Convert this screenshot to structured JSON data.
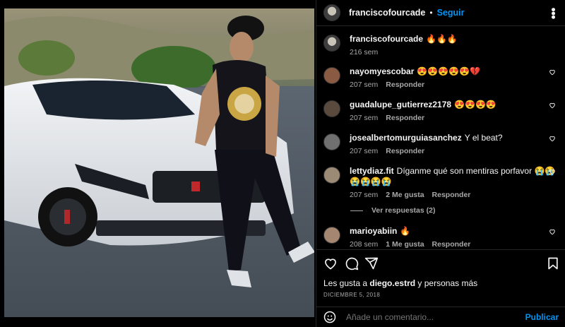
{
  "post": {
    "username": "franciscofourcade",
    "follow_label": "Seguir",
    "more_icon": "more-options-icon",
    "caption_user": "franciscofourcade",
    "caption_text": "🔥🔥🔥",
    "caption_age": "216 sem"
  },
  "comments": [
    {
      "user": "nayomyescobar",
      "text": "😍😍😍😍😍💔",
      "age": "207 sem",
      "likes": "",
      "reply": "Responder"
    },
    {
      "user": "guadalupe_gutierrez2178",
      "text": "😍😍😍😍",
      "age": "207 sem",
      "likes": "",
      "reply": "Responder"
    },
    {
      "user": "josealbertomurguiasanchez",
      "text": "Y el beat?",
      "age": "207 sem",
      "likes": "",
      "reply": "Responder"
    },
    {
      "user": "lettydiaz.fit",
      "text": "Díganme qué son mentiras porfavor 😭😭😭😭😭😭",
      "age": "207 sem",
      "likes": "2 Me gusta",
      "reply": "Responder"
    },
    {
      "user": "marioyabiin",
      "text": "🔥",
      "age": "208 sem",
      "likes": "1 Me gusta",
      "reply": "Responder"
    }
  ],
  "view_replies": "Ver respuestas (2)",
  "likes_line": {
    "prefix": "Les gusta a",
    "user": "diego.estrd",
    "suffix": "y personas más"
  },
  "date": "DICIEMBRE 5, 2018",
  "add_comment": {
    "placeholder": "Añade un comentario...",
    "post_label": "Publicar"
  },
  "colors": {
    "accent": "#0095f6",
    "muted": "#a8a8a8",
    "background": "#000000"
  },
  "icons": [
    "heart-icon",
    "comment-icon",
    "share-icon",
    "bookmark-icon",
    "emoji-icon"
  ]
}
